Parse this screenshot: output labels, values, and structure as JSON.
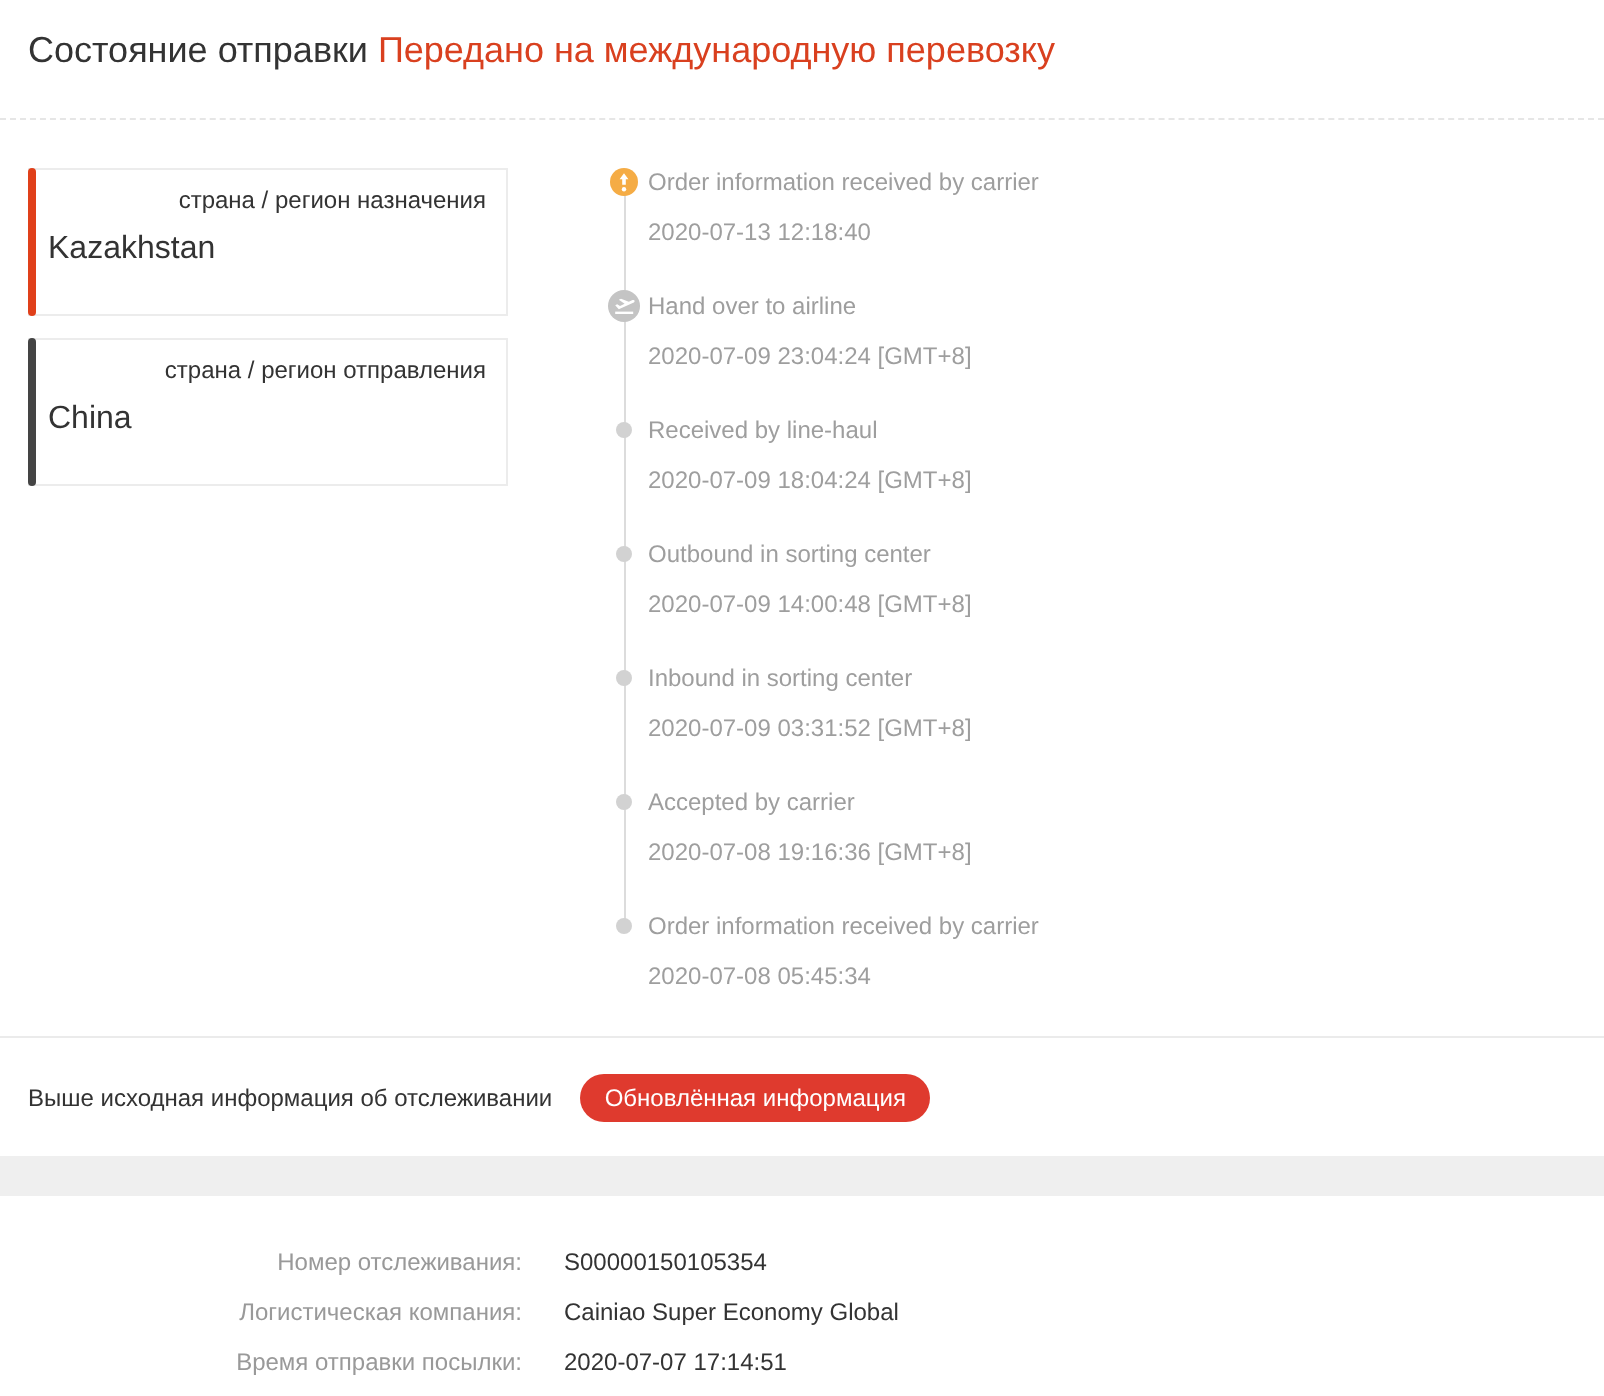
{
  "header": {
    "label": "Состояние отправки",
    "status": "Передано на международную перевозку"
  },
  "route": [
    {
      "label": "страна / регион назначения",
      "country": "Kazakhstan",
      "color": "#e0401a"
    },
    {
      "label": "страна / регион отправления",
      "country": "China",
      "color": "#444444"
    }
  ],
  "events": [
    {
      "kind": "alert",
      "title": "Order information received by carrier",
      "time": "2020-07-13 12:18:40"
    },
    {
      "kind": "plane",
      "title": "Hand over to airline",
      "time": "2020-07-09 23:04:24 [GMT+8]"
    },
    {
      "kind": "dot",
      "title": "Received by line-haul",
      "time": "2020-07-09 18:04:24 [GMT+8]"
    },
    {
      "kind": "dot",
      "title": "Outbound in sorting center",
      "time": "2020-07-09 14:00:48 [GMT+8]"
    },
    {
      "kind": "dot",
      "title": "Inbound in sorting center",
      "time": "2020-07-09 03:31:52 [GMT+8]"
    },
    {
      "kind": "dot",
      "title": "Accepted by carrier",
      "time": "2020-07-08 19:16:36 [GMT+8]"
    },
    {
      "kind": "dot",
      "title": "Order information received by carrier",
      "time": "2020-07-08 05:45:34"
    }
  ],
  "notice": {
    "text": "Выше исходная информация об отслеживании",
    "button": "Обновлённая информация"
  },
  "details": [
    {
      "label": "Номер отслеживания:",
      "value": "S00000150105354"
    },
    {
      "label": "Логистическая компания:",
      "value": "Cainiao Super Economy Global"
    },
    {
      "label": "Время отправки посылки:",
      "value": "2020-07-07 17:14:51"
    }
  ]
}
